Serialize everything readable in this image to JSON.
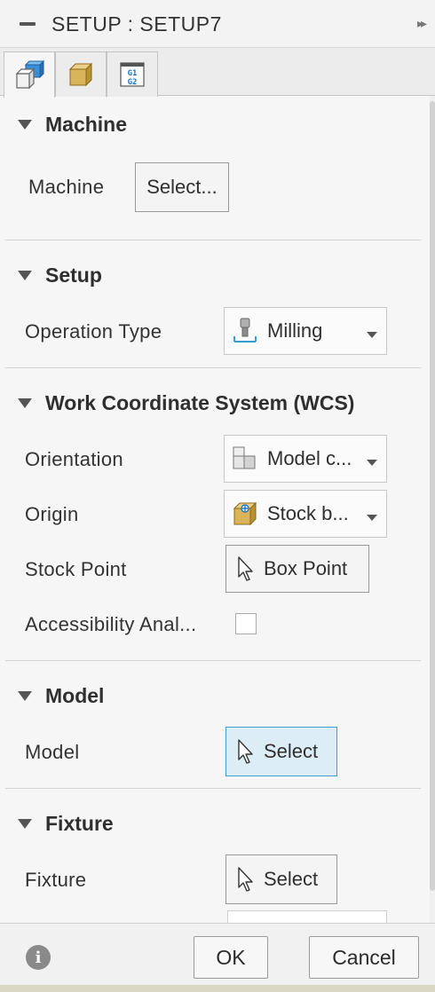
{
  "window": {
    "title": "SETUP : SETUP7"
  },
  "tabs": [
    {
      "name": "setup"
    },
    {
      "name": "stock"
    },
    {
      "name": "post-process"
    }
  ],
  "tab3_icon_text": {
    "line1": "G1",
    "line2": "G2"
  },
  "sections": {
    "machine": {
      "header": "Machine",
      "machine_label": "Machine",
      "select_button": "Select..."
    },
    "setup": {
      "header": "Setup",
      "operation_type_label": "Operation Type",
      "operation_type_value": "Milling"
    },
    "wcs": {
      "header": "Work Coordinate System (WCS)",
      "orientation_label": "Orientation",
      "orientation_value": "Model c...",
      "origin_label": "Origin",
      "origin_value": "Stock b...",
      "stock_point_label": "Stock Point",
      "stock_point_button": "Box Point",
      "accessibility_label": "Accessibility Anal...",
      "accessibility_checked": false
    },
    "model": {
      "header": "Model",
      "model_label": "Model",
      "select_button": "Select"
    },
    "fixture": {
      "header": "Fixture",
      "fixture_label": "Fixture",
      "select_button": "Select"
    }
  },
  "footer": {
    "ok": "OK",
    "cancel": "Cancel"
  },
  "colors": {
    "highlight_border": "#3aa0cf",
    "highlight_bg": "#dcedf5",
    "panel_bg": "#f6f6f6"
  }
}
